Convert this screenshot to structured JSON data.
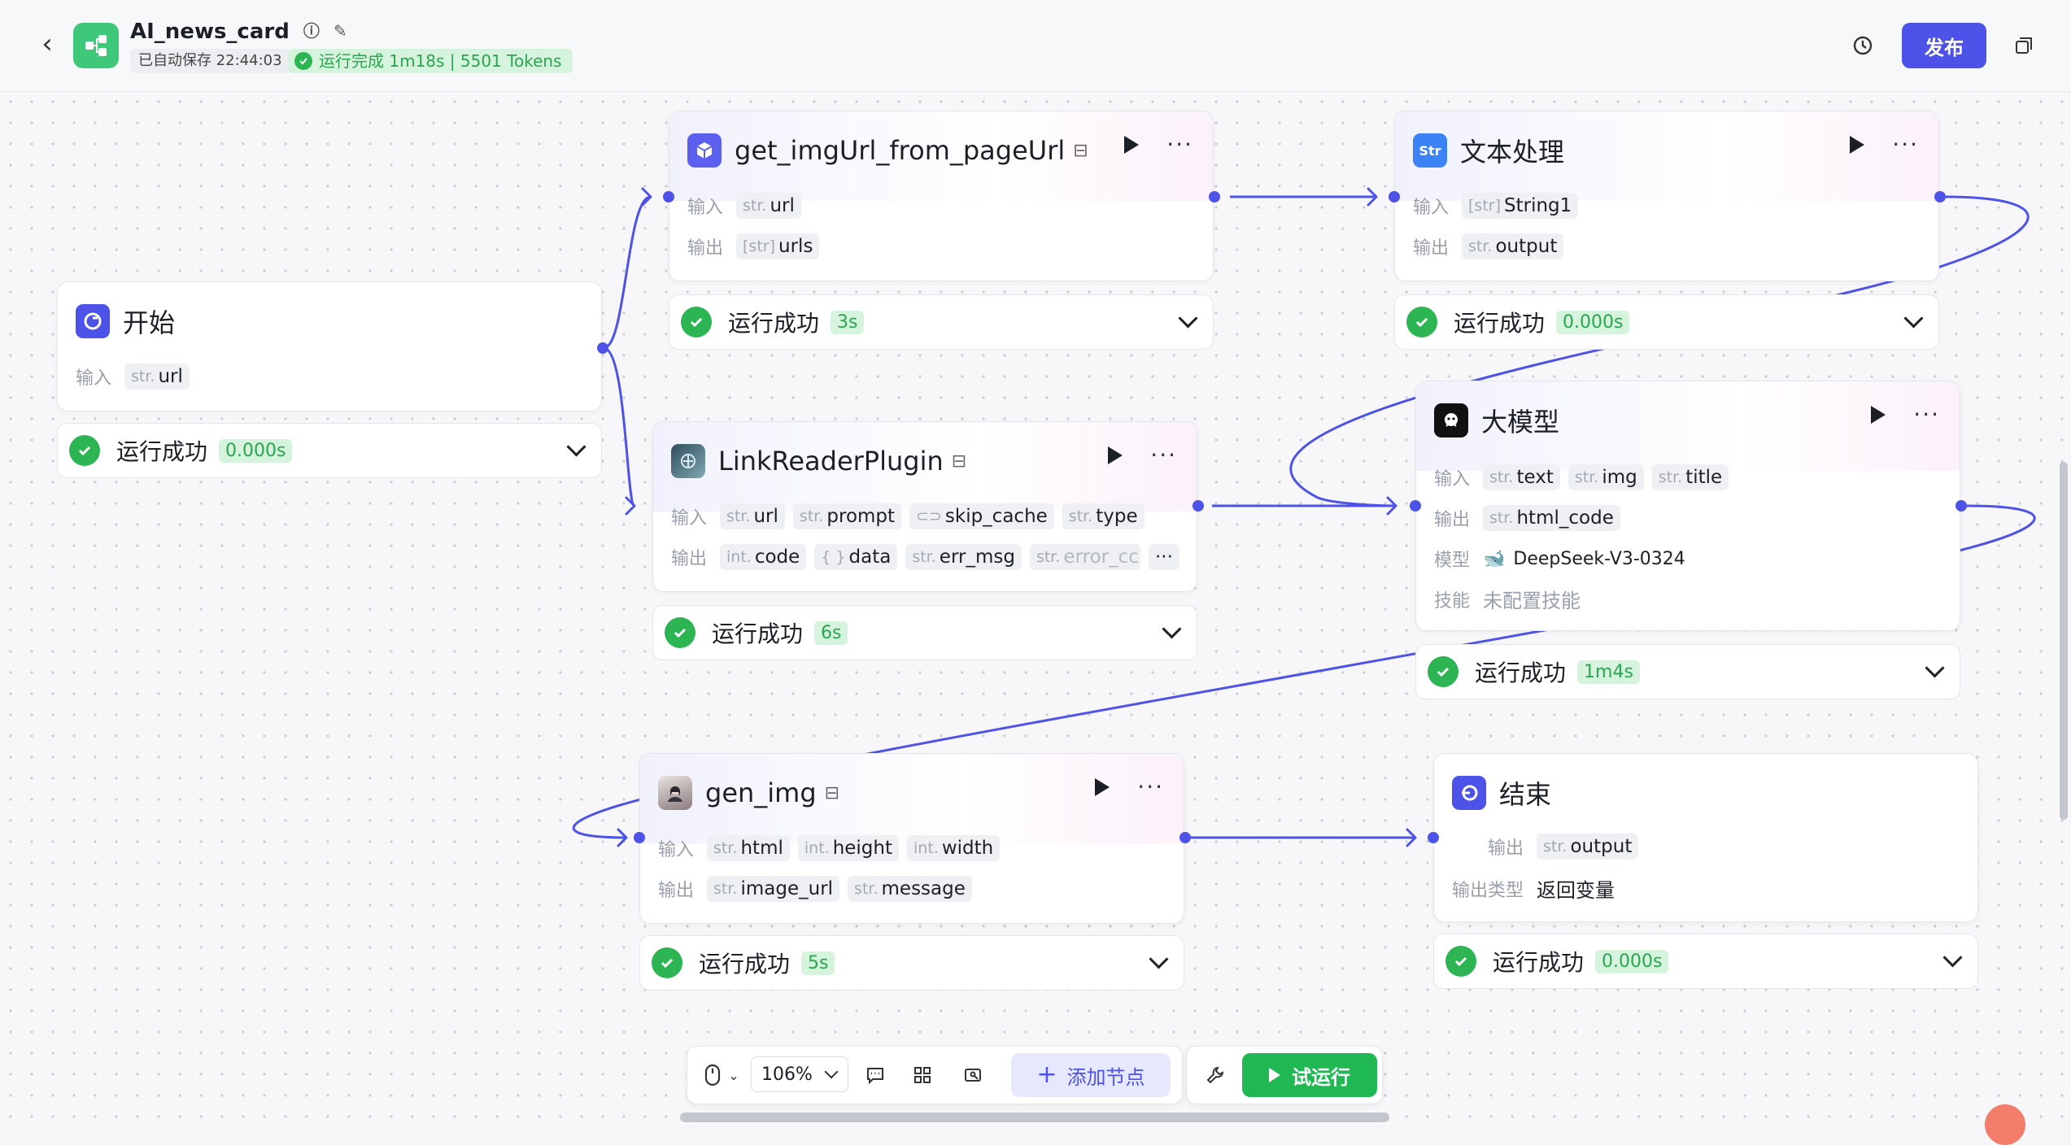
{
  "header": {
    "app_title": "AI_news_card",
    "autosave": "已自动保存 22:44:03",
    "run_status": "运行完成 1m18s | 5501 Tokens",
    "publish_label": "发布",
    "brand_color": "#4d53e8",
    "success_color": "#2cb552"
  },
  "io_labels": {
    "input": "输入",
    "output": "输出",
    "model": "模型",
    "skill": "技能",
    "output_type": "输出类型"
  },
  "nodes": {
    "start": {
      "title": "开始",
      "inputs": [
        {
          "type": "str.",
          "name": "url"
        }
      ],
      "status": "运行成功",
      "time": "0.000s"
    },
    "get_img": {
      "title": "get_imgUrl_from_pageUrl",
      "inputs": [
        {
          "type": "str.",
          "name": "url"
        }
      ],
      "outputs": [
        {
          "type": "[str]",
          "name": "urls"
        }
      ],
      "status": "运行成功",
      "time": "3s"
    },
    "text_proc": {
      "title": "文本处理",
      "inputs": [
        {
          "type": "[str]",
          "name": "String1"
        }
      ],
      "outputs": [
        {
          "type": "str.",
          "name": "output"
        }
      ],
      "status": "运行成功",
      "time": "0.000s"
    },
    "link_reader": {
      "title": "LinkReaderPlugin",
      "inputs": [
        {
          "type": "str.",
          "name": "url"
        },
        {
          "type": "str.",
          "name": "prompt"
        },
        {
          "type": "toggle",
          "name": "skip_cache"
        },
        {
          "type": "str.",
          "name": "type"
        }
      ],
      "outputs": [
        {
          "type": "int.",
          "name": "code"
        },
        {
          "type": "{ }",
          "name": "data"
        },
        {
          "type": "str.",
          "name": "err_msg"
        },
        {
          "type": "str.",
          "name": "error_cc"
        }
      ],
      "more": "···",
      "status": "运行成功",
      "time": "6s"
    },
    "llm": {
      "title": "大模型",
      "inputs": [
        {
          "type": "str.",
          "name": "text"
        },
        {
          "type": "str.",
          "name": "img"
        },
        {
          "type": "str.",
          "name": "title"
        }
      ],
      "outputs": [
        {
          "type": "str.",
          "name": "html_code"
        }
      ],
      "model": "DeepSeek-V3-0324",
      "skill": "未配置技能",
      "status": "运行成功",
      "time": "1m4s"
    },
    "gen_img": {
      "title": "gen_img",
      "inputs": [
        {
          "type": "str.",
          "name": "html"
        },
        {
          "type": "int.",
          "name": "height"
        },
        {
          "type": "int.",
          "name": "width"
        }
      ],
      "outputs": [
        {
          "type": "str.",
          "name": "image_url"
        },
        {
          "type": "str.",
          "name": "message"
        }
      ],
      "status": "运行成功",
      "time": "5s"
    },
    "end": {
      "title": "结束",
      "outputs": [
        {
          "type": "str.",
          "name": "output"
        }
      ],
      "output_type": "返回变量",
      "status": "运行成功",
      "time": "0.000s"
    }
  },
  "toolbar": {
    "zoom": "106%",
    "add_node": "添加节点",
    "try_run": "试运行"
  }
}
